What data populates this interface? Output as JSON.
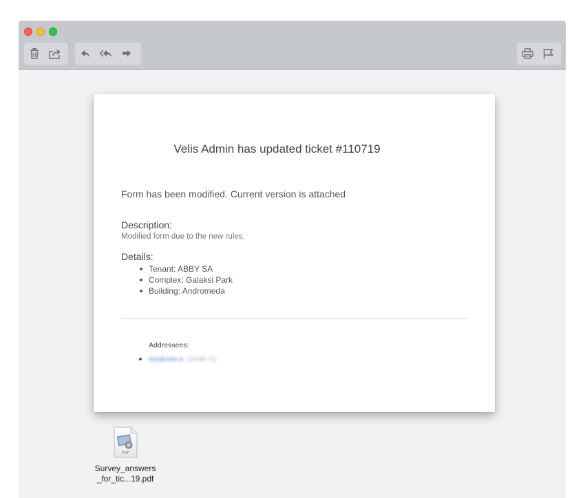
{
  "toolbar": {
    "left_group_1": [
      "trash-icon",
      "share-icon"
    ],
    "left_group_2": [
      "reply-icon",
      "reply-all-icon",
      "forward-icon"
    ],
    "right_group": [
      "print-icon",
      "flag-icon"
    ]
  },
  "email": {
    "headline": "Velis Admin has updated ticket #110719",
    "intro": "Form has been modified. Current version is attached",
    "description_label": "Description:",
    "description_text": "Modified form due to the new rules.",
    "details_label": "Details:",
    "details": [
      "Tenant: ABBY SA",
      "Complex: Galaksi Park",
      "Building: Andromeda"
    ],
    "addressees_label": "Addressees:",
    "addressees": [
      {
        "email": "test@velis.si",
        "extra": "(10:48 +1)"
      }
    ]
  },
  "attachment": {
    "icon": "pdf-file-icon",
    "badge": "PDF",
    "name_line1": "Survey_answers",
    "name_line2": "_for_tic...19.pdf"
  },
  "colors": {
    "titlebar": "#c5c8cc",
    "background": "#f1f2f4",
    "close": "#fe5f57",
    "minimize": "#febc2e",
    "maximize": "#28c840",
    "link": "#4d7fd6"
  }
}
